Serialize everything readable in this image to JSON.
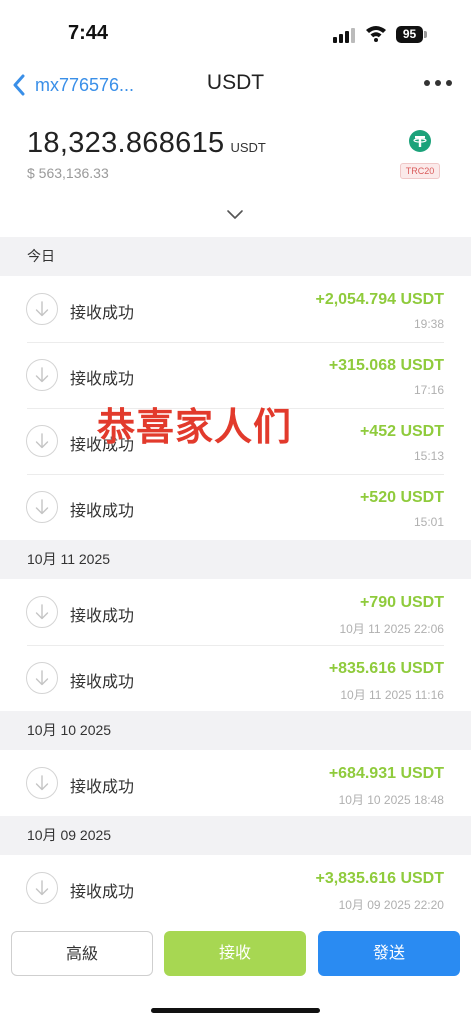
{
  "status_bar": {
    "time": "7:44",
    "battery": "95"
  },
  "nav": {
    "account": "mx776576...",
    "title": "USDT"
  },
  "balance": {
    "amount": "18,323.868615",
    "unit": "USDT",
    "fiat": "$ 563,136.33",
    "network": "TRC20"
  },
  "sections": [
    {
      "header": "今日",
      "rows": [
        {
          "label": "接收成功",
          "amount": "+2,054.794 USDT",
          "time": "19:38"
        },
        {
          "label": "接收成功",
          "amount": "+315.068 USDT",
          "time": "17:16"
        },
        {
          "label": "接收成功",
          "amount": "+452 USDT",
          "time": "15:13"
        },
        {
          "label": "接收成功",
          "amount": "+520 USDT",
          "time": "15:01"
        }
      ]
    },
    {
      "header": "10月 11 2025",
      "rows": [
        {
          "label": "接收成功",
          "amount": "+790 USDT",
          "time": "10月 11 2025 22:06"
        },
        {
          "label": "接收成功",
          "amount": "+835.616 USDT",
          "time": "10月 11 2025 11:16"
        }
      ]
    },
    {
      "header": "10月 10 2025",
      "rows": [
        {
          "label": "接收成功",
          "amount": "+684.931 USDT",
          "time": "10月 10 2025 18:48"
        }
      ]
    },
    {
      "header": "10月 09 2025",
      "rows": [
        {
          "label": "接收成功",
          "amount": "+3,835.616 USDT",
          "time": "10月 09 2025 22:20"
        }
      ]
    }
  ],
  "overlay_text": "恭喜家人们",
  "buttons": {
    "advanced": "高級",
    "receive": "接收",
    "send": "發送"
  },
  "colors": {
    "accent_blue": "#2a8bf2",
    "receive_green": "#a7d752",
    "amount_green": "#8fcb3c",
    "overlay_red": "#e23a2c",
    "token_green": "#1ba27a"
  },
  "icons": [
    "signal-icon",
    "wifi-icon",
    "back-chevron-icon",
    "more-icon",
    "tether-icon",
    "chevron-down-icon",
    "receive-arrow-icon"
  ]
}
